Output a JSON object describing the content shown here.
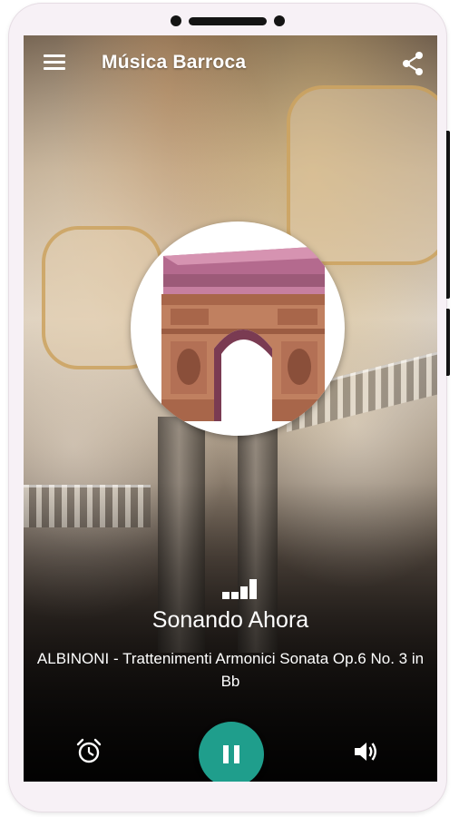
{
  "app": {
    "title": "Música Barroca"
  },
  "icons": {
    "menu": "menu-icon",
    "share": "share-icon",
    "equalizer": "equalizer-icon",
    "alarm": "alarm-icon",
    "pause": "pause-icon",
    "volume": "volume-icon"
  },
  "player": {
    "status": "Sonando Ahora",
    "track": "ALBINONI - Trattenimenti Armonici Sonata Op.6 No. 3 in Bb",
    "is_playing": true
  },
  "colors": {
    "accent": "#1f9e8c",
    "text": "#ffffff",
    "device_frame": "#f7f1f6"
  }
}
